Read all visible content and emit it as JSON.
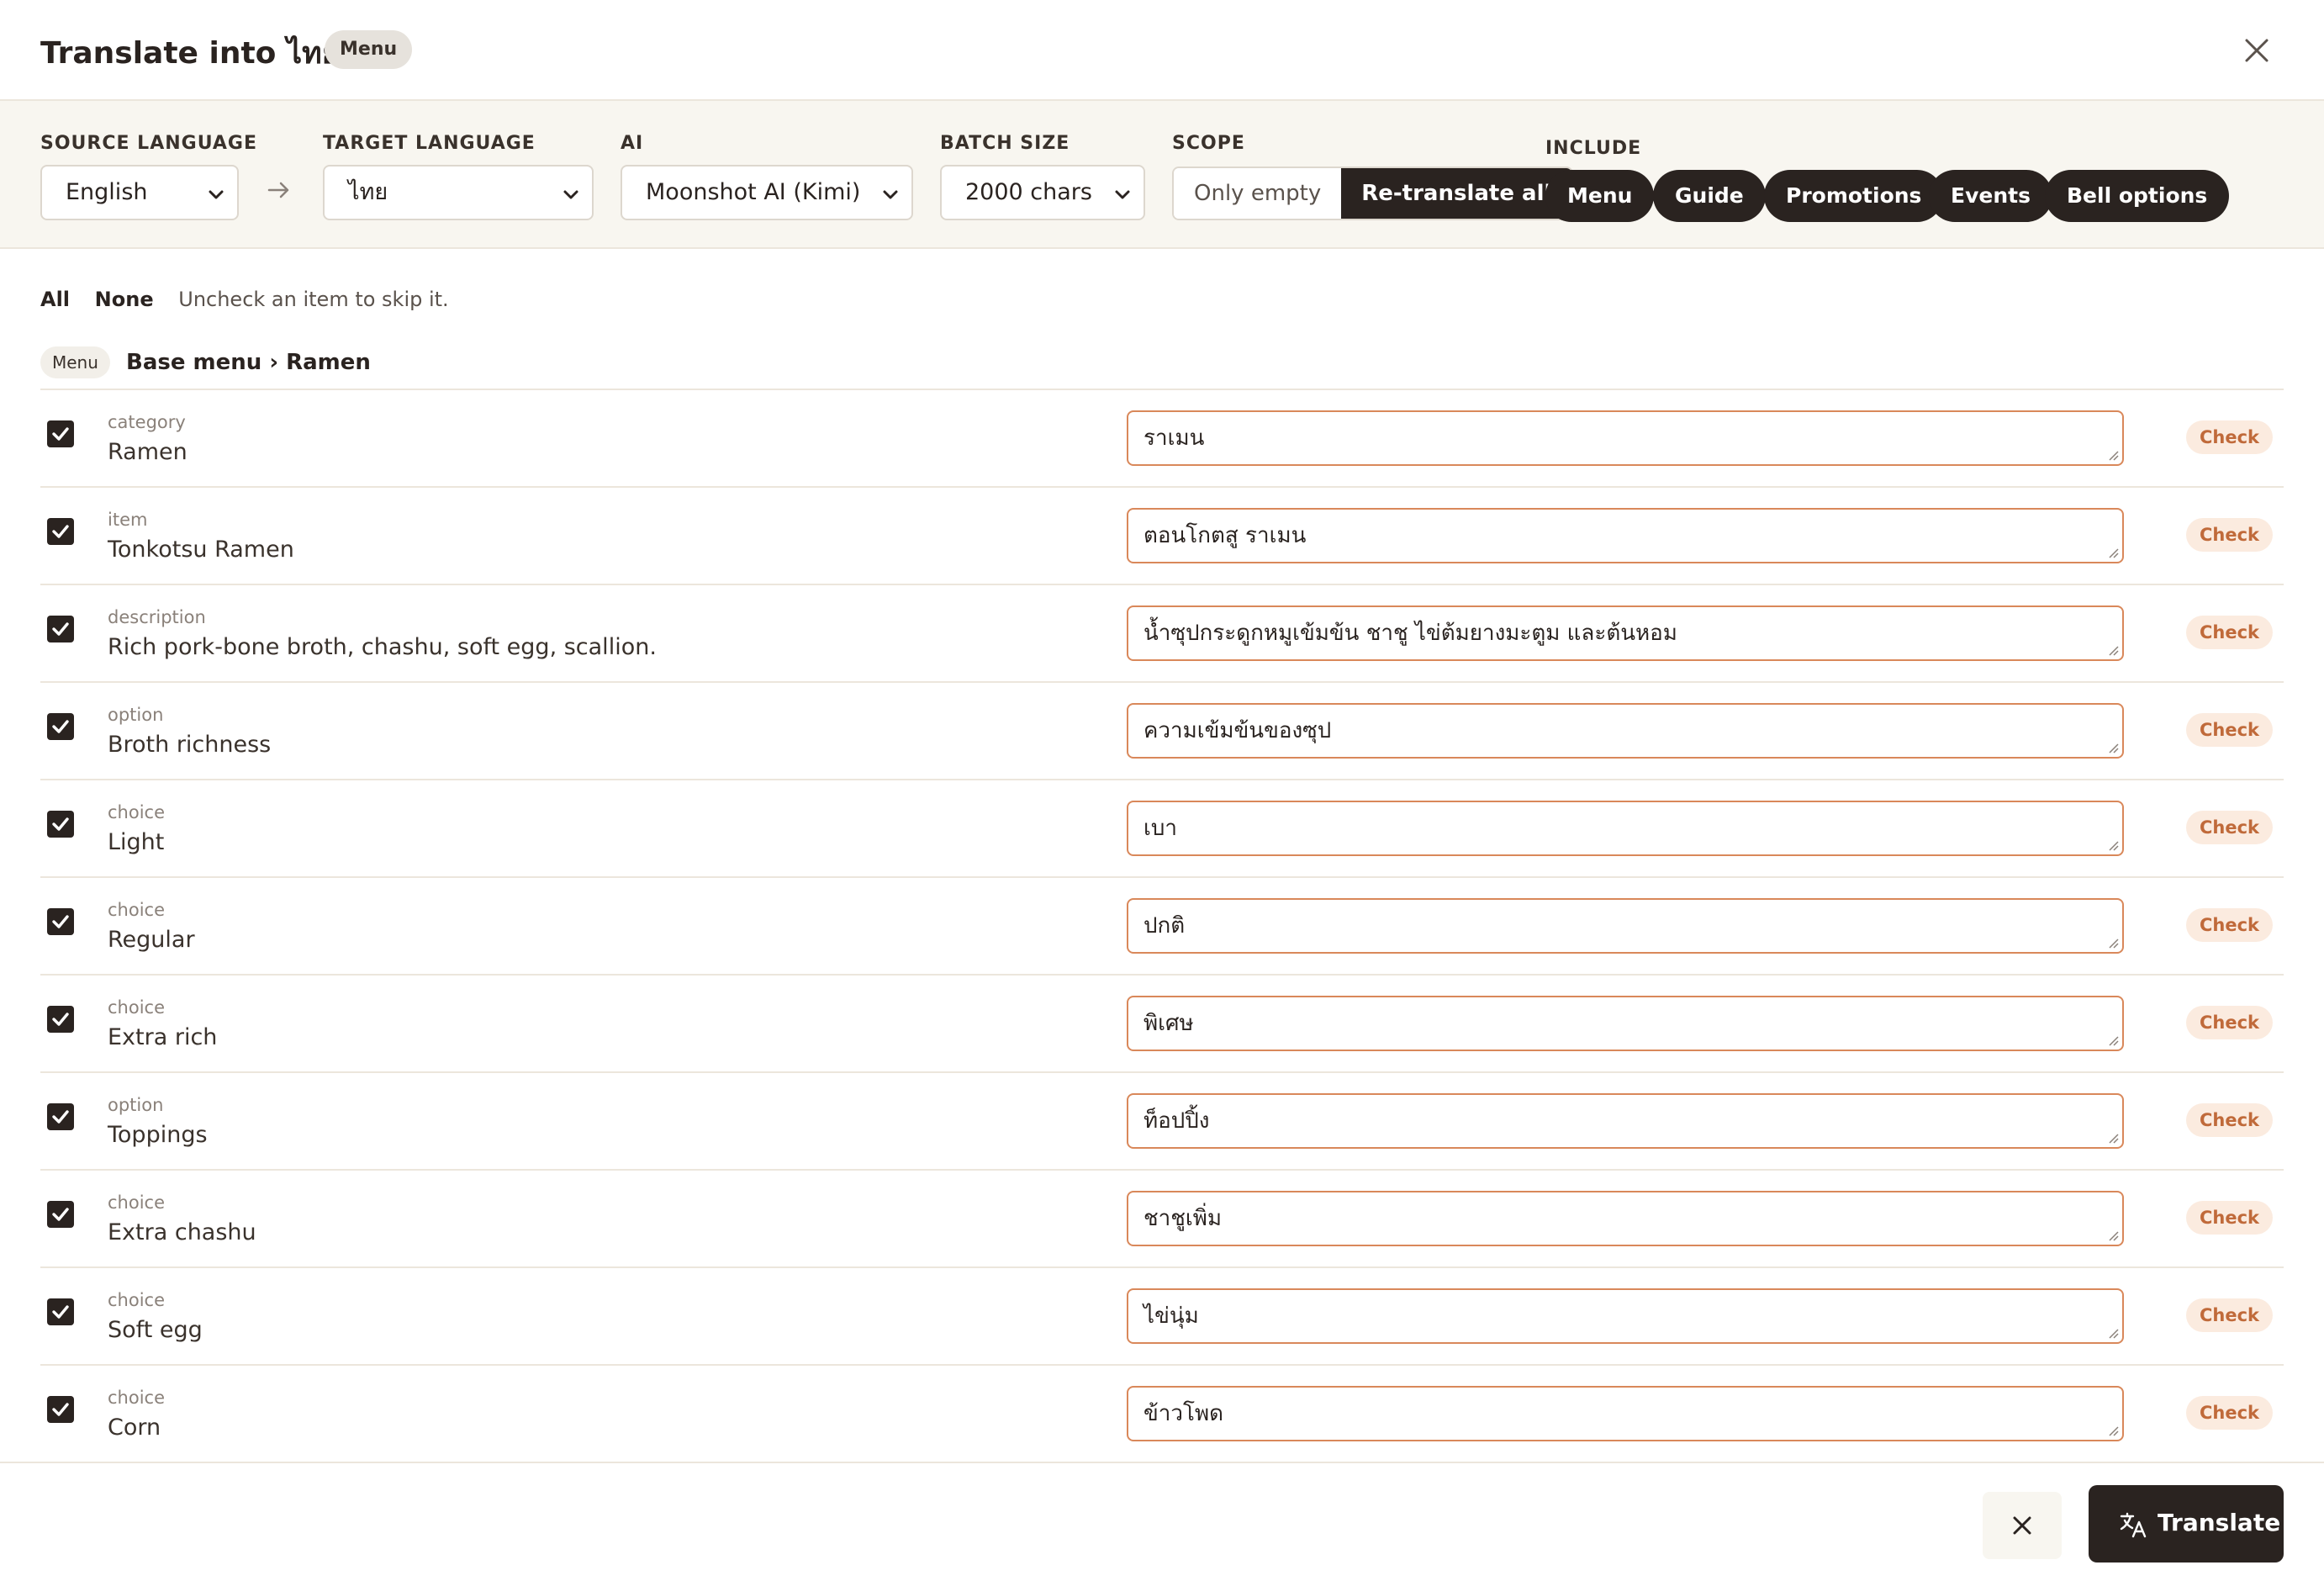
{
  "header": {
    "title": "Translate into ไทย",
    "badge": "Menu"
  },
  "toolbar": {
    "source_language": {
      "label": "SOURCE LANGUAGE",
      "value": "English"
    },
    "target_language": {
      "label": "TARGET LANGUAGE",
      "value": "ไทย"
    },
    "ai": {
      "label": "AI",
      "value": "Moonshot AI (Kimi)"
    },
    "batch_size": {
      "label": "BATCH SIZE",
      "value": "2000 chars"
    },
    "scope": {
      "label": "SCOPE",
      "options": [
        "Only empty",
        "Re-translate all"
      ],
      "selected": "Re-translate all"
    },
    "include": {
      "label": "INCLUDE",
      "chips": [
        "Menu",
        "Guide",
        "Promotions",
        "Events",
        "Bell options"
      ]
    }
  },
  "selection": {
    "all_label": "All",
    "none_label": "None",
    "hint": "Uncheck an item to skip it."
  },
  "breadcrumb": {
    "badge": "Menu",
    "path": "Base menu › Ramen"
  },
  "check_label": "Check",
  "items": [
    {
      "kind": "category",
      "source": "Ramen",
      "translation": "ราเมน",
      "checked": true
    },
    {
      "kind": "item",
      "source": "Tonkotsu Ramen",
      "translation": "ตอนโกตสู ราเมน",
      "checked": true
    },
    {
      "kind": "description",
      "source": "Rich pork-bone broth, chashu, soft egg, scallion.",
      "translation": "น้ำซุปกระดูกหมูเข้มข้น ชาชู ไข่ต้มยางมะตูม และต้นหอม",
      "checked": true
    },
    {
      "kind": "option",
      "source": "Broth richness",
      "translation": "ความเข้มข้นของซุป",
      "checked": true
    },
    {
      "kind": "choice",
      "source": "Light",
      "translation": "เบา",
      "checked": true
    },
    {
      "kind": "choice",
      "source": "Regular",
      "translation": "ปกติ",
      "checked": true
    },
    {
      "kind": "choice",
      "source": "Extra rich",
      "translation": "พิเศษ",
      "checked": true
    },
    {
      "kind": "option",
      "source": "Toppings",
      "translation": "ท็อปปิ้ง",
      "checked": true
    },
    {
      "kind": "choice",
      "source": "Extra chashu",
      "translation": "ชาชูเพิ่ม",
      "checked": true
    },
    {
      "kind": "choice",
      "source": "Soft egg",
      "translation": "ไข่นุ่ม",
      "checked": true
    },
    {
      "kind": "choice",
      "source": "Corn",
      "translation": "ข้าวโพด",
      "checked": true
    }
  ],
  "footer": {
    "translate_label": "Translate"
  },
  "colors": {
    "primary_dark": "#2a2320",
    "accent_orange": "#d9885a",
    "check_badge_bg": "#fbebdf",
    "check_badge_text": "#c06a3a",
    "toolbar_bg": "#f8f6f0"
  },
  "icons": {
    "close": "close-icon",
    "arrow": "arrow-right-icon",
    "chevron": "chevron-down-icon",
    "checkbox": "checkmark-icon",
    "translate": "translate-icon"
  }
}
